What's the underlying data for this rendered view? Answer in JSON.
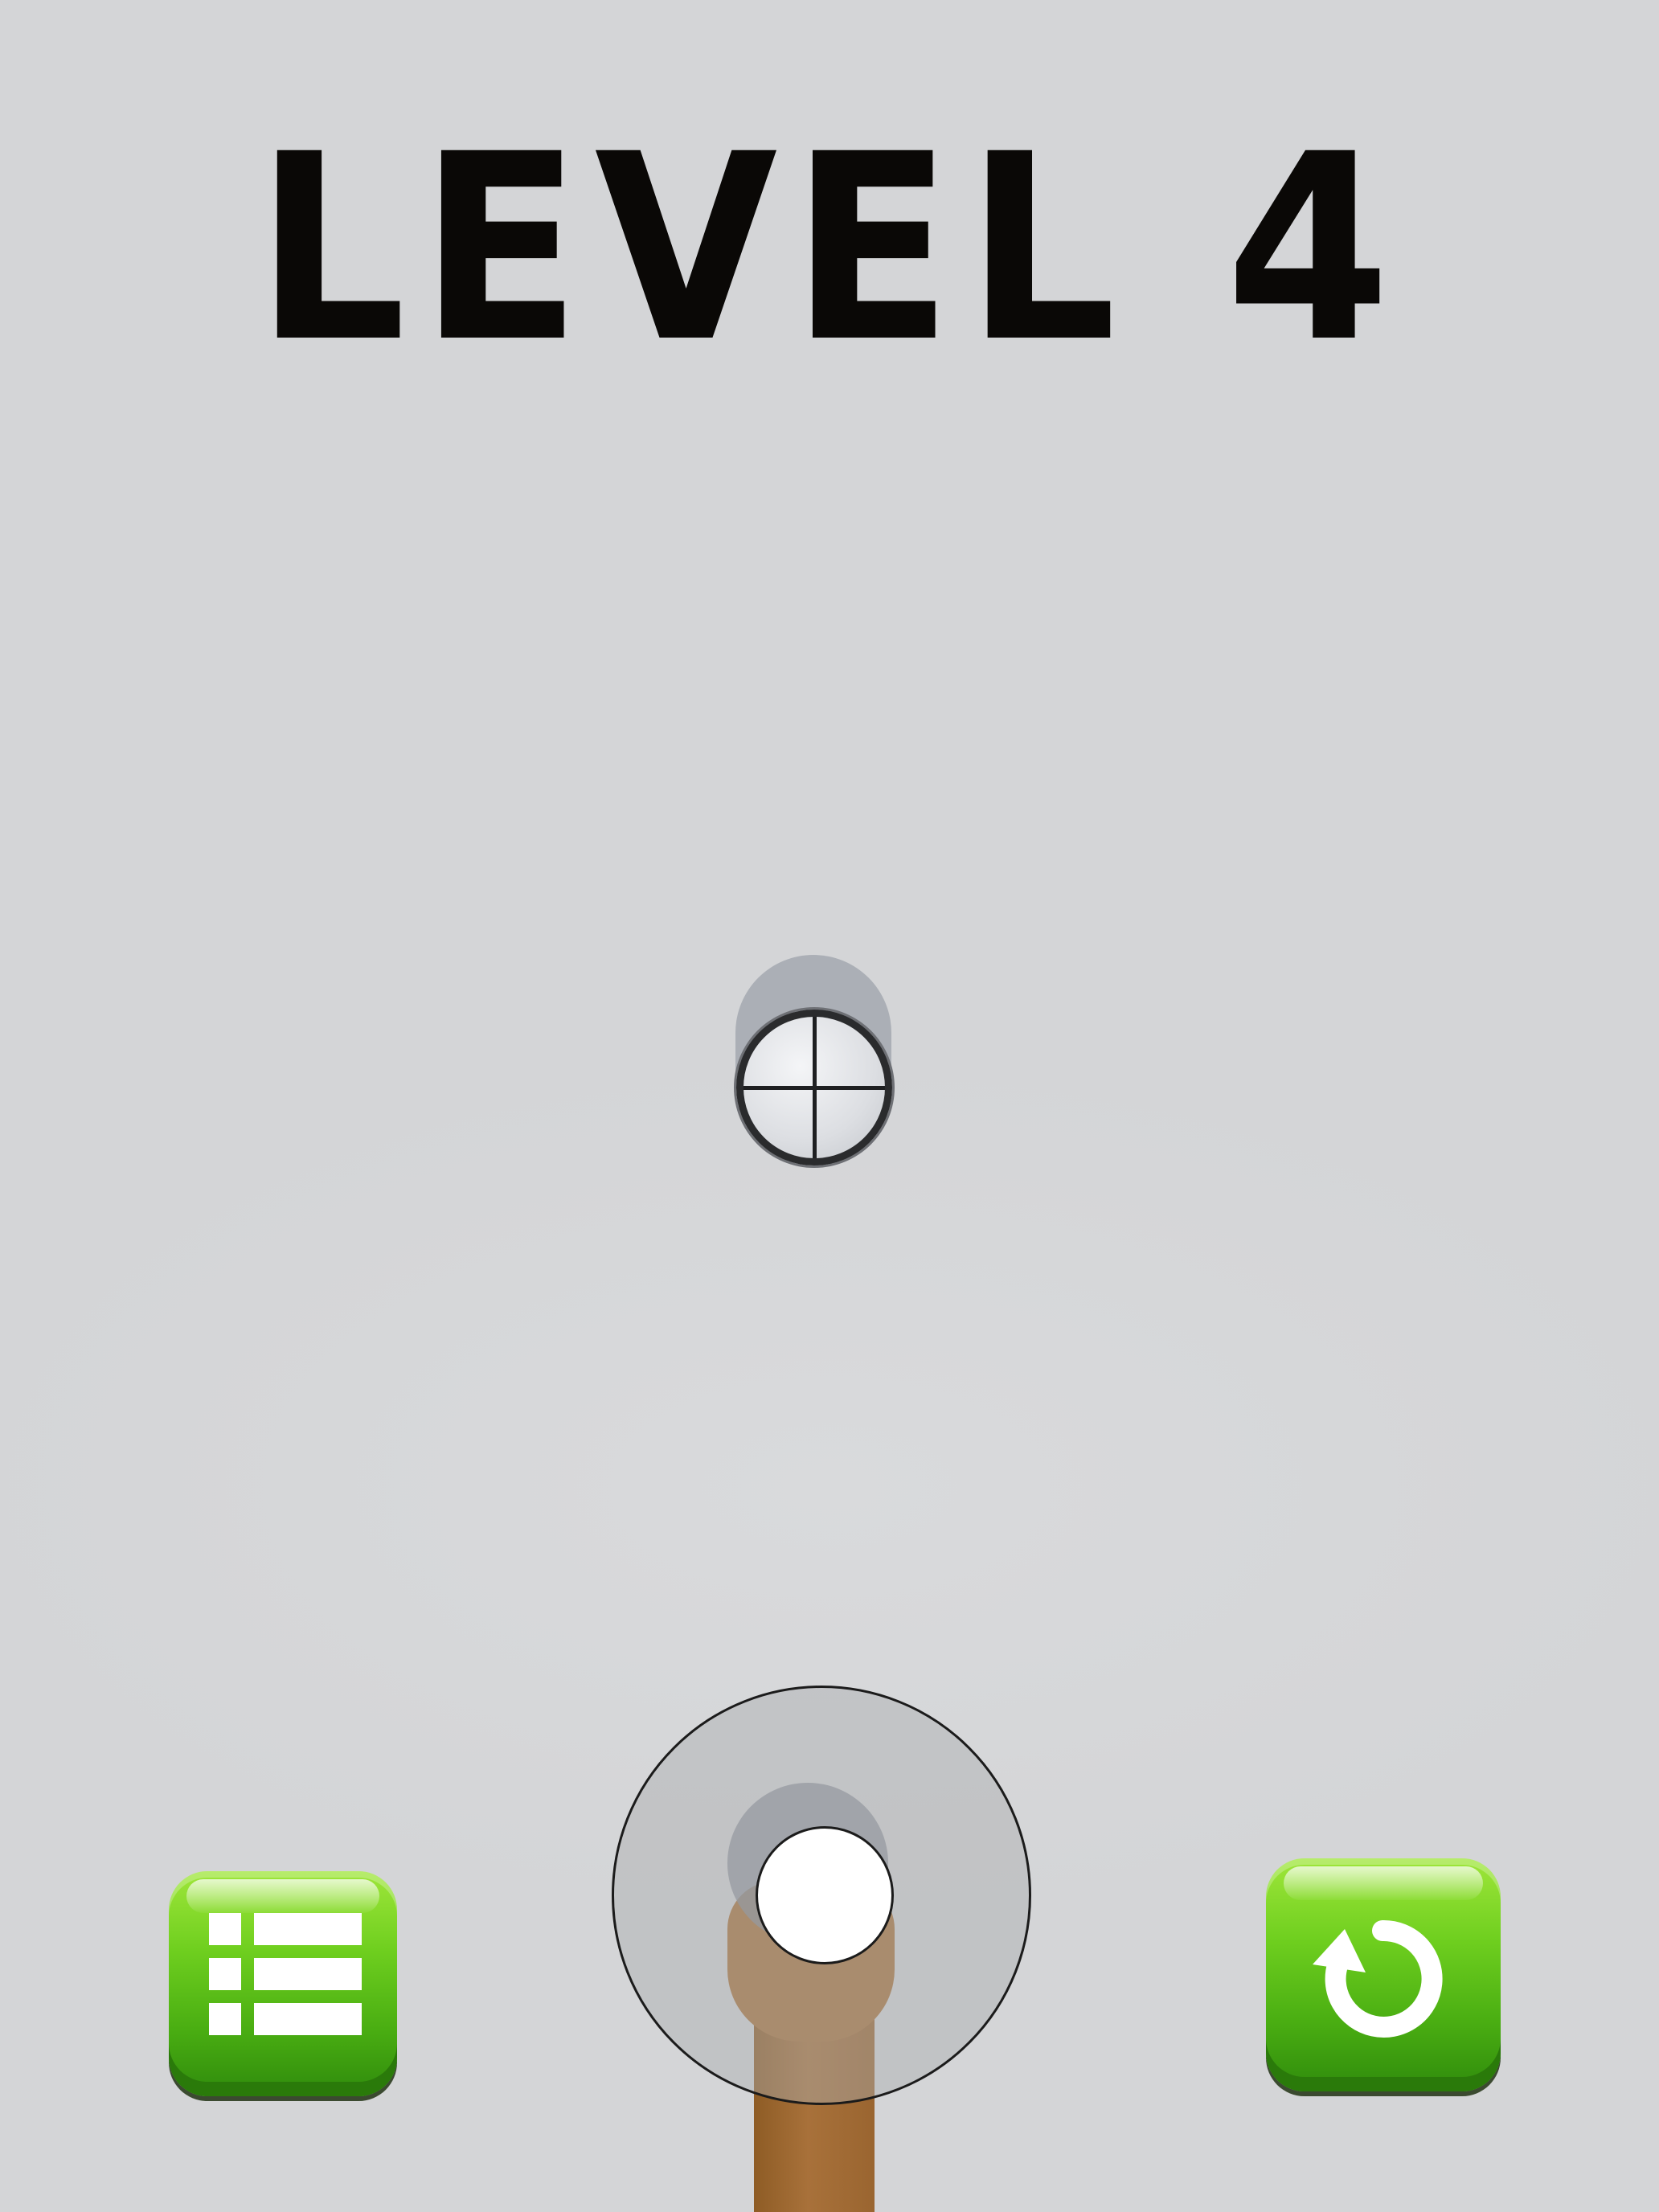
{
  "hud": {
    "level_label": "LEVEL 4"
  },
  "colors": {
    "background": "#d4d5d7",
    "title": "#0a0806",
    "button_green": "#5cc11a",
    "stick_brown": "#a8713a"
  },
  "icons": {
    "menu_button": "level-list-icon",
    "restart_button": "restart-icon",
    "target": "crosshair-icon"
  }
}
